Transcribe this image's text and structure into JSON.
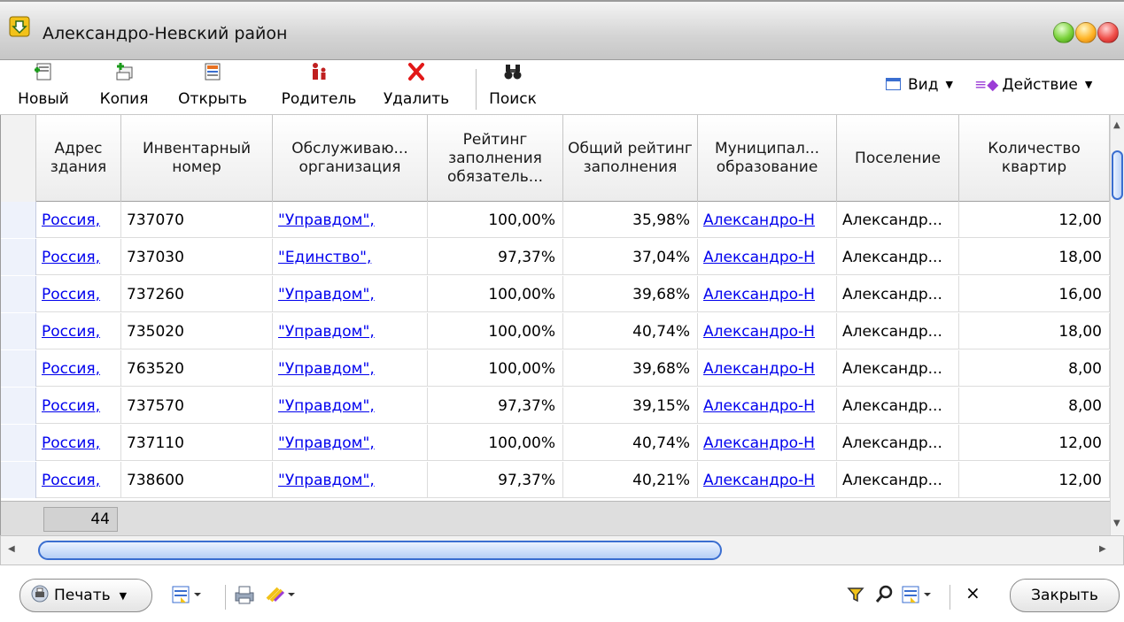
{
  "window": {
    "title": "Александро-Невский район"
  },
  "toolbar": {
    "buttons": [
      {
        "label": "Новый",
        "icon": "new-record-icon"
      },
      {
        "label": "Копия",
        "icon": "copy-record-icon"
      },
      {
        "label": "Открыть",
        "icon": "open-record-icon"
      },
      {
        "label": "Родитель",
        "icon": "parent-record-icon"
      },
      {
        "label": "Удалить",
        "icon": "delete-icon"
      },
      {
        "label": "Поиск",
        "icon": "binoculars-icon"
      }
    ],
    "view_label": "Вид",
    "action_label": "Действие"
  },
  "grid": {
    "columns": [
      "Адрес здания",
      "Инвентарный номер",
      "Обслуживаю... организация",
      "Рейтинг заполнения обязатель...",
      "Общий рейтинг заполнения",
      "Муниципал... образование",
      "Поселение",
      "Количество квартир"
    ],
    "rows": [
      {
        "address": "Россия,",
        "inv": "737070",
        "org": "\"Управдом\",",
        "req": "100,00%",
        "total": "35,98%",
        "mun": "Александро-Н",
        "settl": "Александр...",
        "apts": "12,00"
      },
      {
        "address": "Россия,",
        "inv": "737030",
        "org": "\"Единство\",",
        "req": "97,37%",
        "total": "37,04%",
        "mun": "Александро-Н",
        "settl": "Александр...",
        "apts": "18,00"
      },
      {
        "address": "Россия,",
        "inv": "737260",
        "org": "\"Управдом\",",
        "req": "100,00%",
        "total": "39,68%",
        "mun": "Александро-Н",
        "settl": "Александр...",
        "apts": "16,00"
      },
      {
        "address": "Россия,",
        "inv": "735020",
        "org": "\"Управдом\",",
        "req": "100,00%",
        "total": "40,74%",
        "mun": "Александро-Н",
        "settl": "Александр...",
        "apts": "18,00"
      },
      {
        "address": "Россия,",
        "inv": "763520",
        "org": "\"Управдом\",",
        "req": "100,00%",
        "total": "39,68%",
        "mun": "Александро-Н",
        "settl": "Александр...",
        "apts": "8,00"
      },
      {
        "address": "Россия,",
        "inv": "737570",
        "org": "\"Управдом\",",
        "req": "97,37%",
        "total": "39,15%",
        "mun": "Александро-Н",
        "settl": "Александр...",
        "apts": "8,00"
      },
      {
        "address": "Россия,",
        "inv": "737110",
        "org": "\"Управдом\",",
        "req": "100,00%",
        "total": "40,74%",
        "mun": "Александро-Н",
        "settl": "Александр...",
        "apts": "12,00"
      },
      {
        "address": "Россия,",
        "inv": "738600",
        "org": "\"Управдом\",",
        "req": "97,37%",
        "total": "40,21%",
        "mun": "Александро-Н",
        "settl": "Александр...",
        "apts": "12,00"
      }
    ],
    "record_count": "44"
  },
  "bottombar": {
    "print_label": "Печать",
    "close_label": "Закрыть"
  },
  "colors": {
    "link": "#0000ee",
    "scroll_accent": "#3a6ed0"
  }
}
